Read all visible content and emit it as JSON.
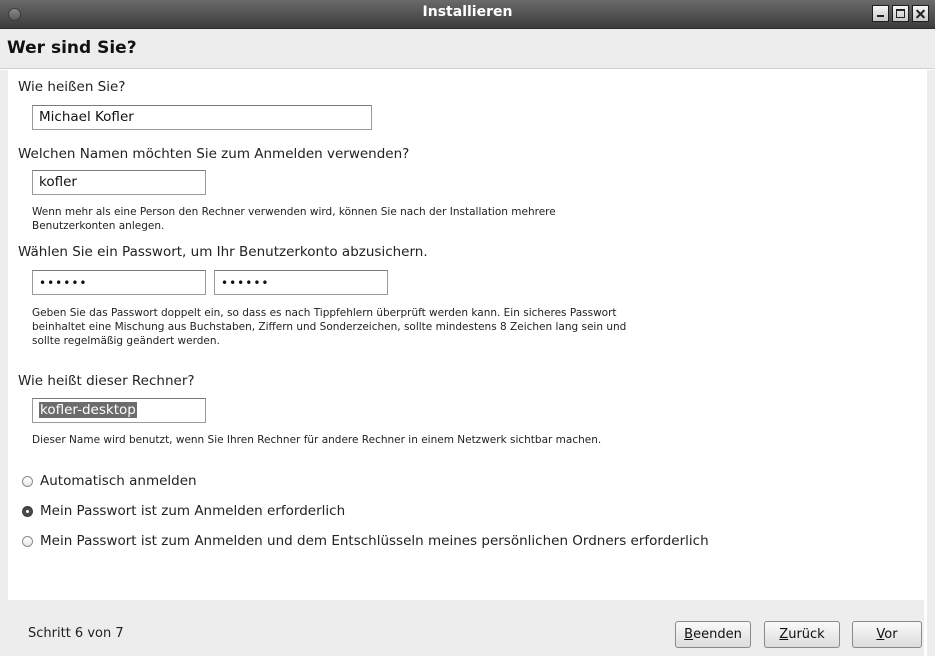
{
  "window": {
    "title": "Installieren"
  },
  "page": {
    "heading": "Wer sind Sie?"
  },
  "name_section": {
    "label": "Wie heißen Sie?",
    "value": "Michael Kofler"
  },
  "login_section": {
    "label": "Welchen Namen möchten Sie zum Anmelden verwenden?",
    "value": "kofler",
    "hint_line1": "Wenn mehr als eine Person den Rechner verwenden wird, können Sie nach der Installation mehrere",
    "hint_line2": "Benutzerkonten anlegen."
  },
  "password_section": {
    "label": "Wählen Sie ein Passwort, um Ihr Benutzerkonto abzusichern.",
    "password_value": "••••••",
    "confirm_value": "••••••",
    "hint_line1": "Geben Sie das Passwort doppelt ein, so dass es nach Tippfehlern überprüft werden kann. Ein sicheres Passwort",
    "hint_line2": "beinhaltet eine Mischung aus Buchstaben, Ziffern und Sonderzeichen, sollte mindestens 8 Zeichen lang sein und",
    "hint_line3": "sollte regelmäßig geändert werden."
  },
  "computer_section": {
    "label": "Wie heißt dieser Rechner?",
    "value": "kofler-desktop",
    "hint": "Dieser Name wird benutzt, wenn Sie Ihren Rechner für andere Rechner in einem Netzwerk sichtbar machen."
  },
  "login_options": [
    {
      "label": "Automatisch anmelden",
      "selected": false
    },
    {
      "label": "Mein Passwort ist zum Anmelden erforderlich",
      "selected": true
    },
    {
      "label": "Mein Passwort ist zum Anmelden und dem Entschlüsseln meines persönlichen Ordners erforderlich",
      "selected": false
    }
  ],
  "footer": {
    "step_text": "Schritt 6 von 7",
    "quit_label_mnemonic": "B",
    "quit_label_rest": "eenden",
    "back_label_mnemonic": "Z",
    "back_label_rest": "urück",
    "forward_label_mnemonic": "V",
    "forward_label_rest": "or"
  },
  "colors": {
    "titlebar": "#4a4a4a",
    "panel": "#ededed",
    "selection": "#6c6c6c"
  }
}
